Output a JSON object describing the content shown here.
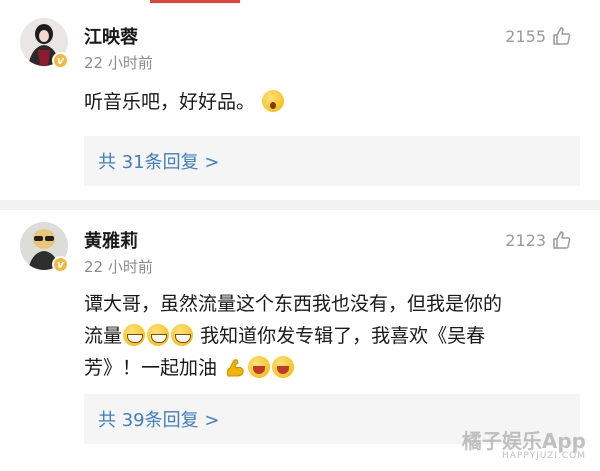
{
  "comments": [
    {
      "name": "江映蓉",
      "time": "22 小时前",
      "likes": "2155",
      "body_text": "听音乐吧，好好品。",
      "reply_label": "共 31条回复 >"
    },
    {
      "name": "黄雅莉",
      "time": "22 小时前",
      "likes": "2123",
      "body_line1": "谭大哥，虽然流量这个东西我也没有，但我是你的",
      "body_line2a": "流量",
      "body_line2b": "我知道你发专辑了，我喜欢《吴春",
      "body_line3a": "芳》！一起加油",
      "reply_label": "共 39条回复 >"
    }
  ],
  "watermark": {
    "text": "橘子娱乐App",
    "sub": "HAPPYJUZI.COM"
  },
  "colors": {
    "accent": "#e0443a",
    "link": "#3f7fc4",
    "verified": "#f6b73c"
  }
}
